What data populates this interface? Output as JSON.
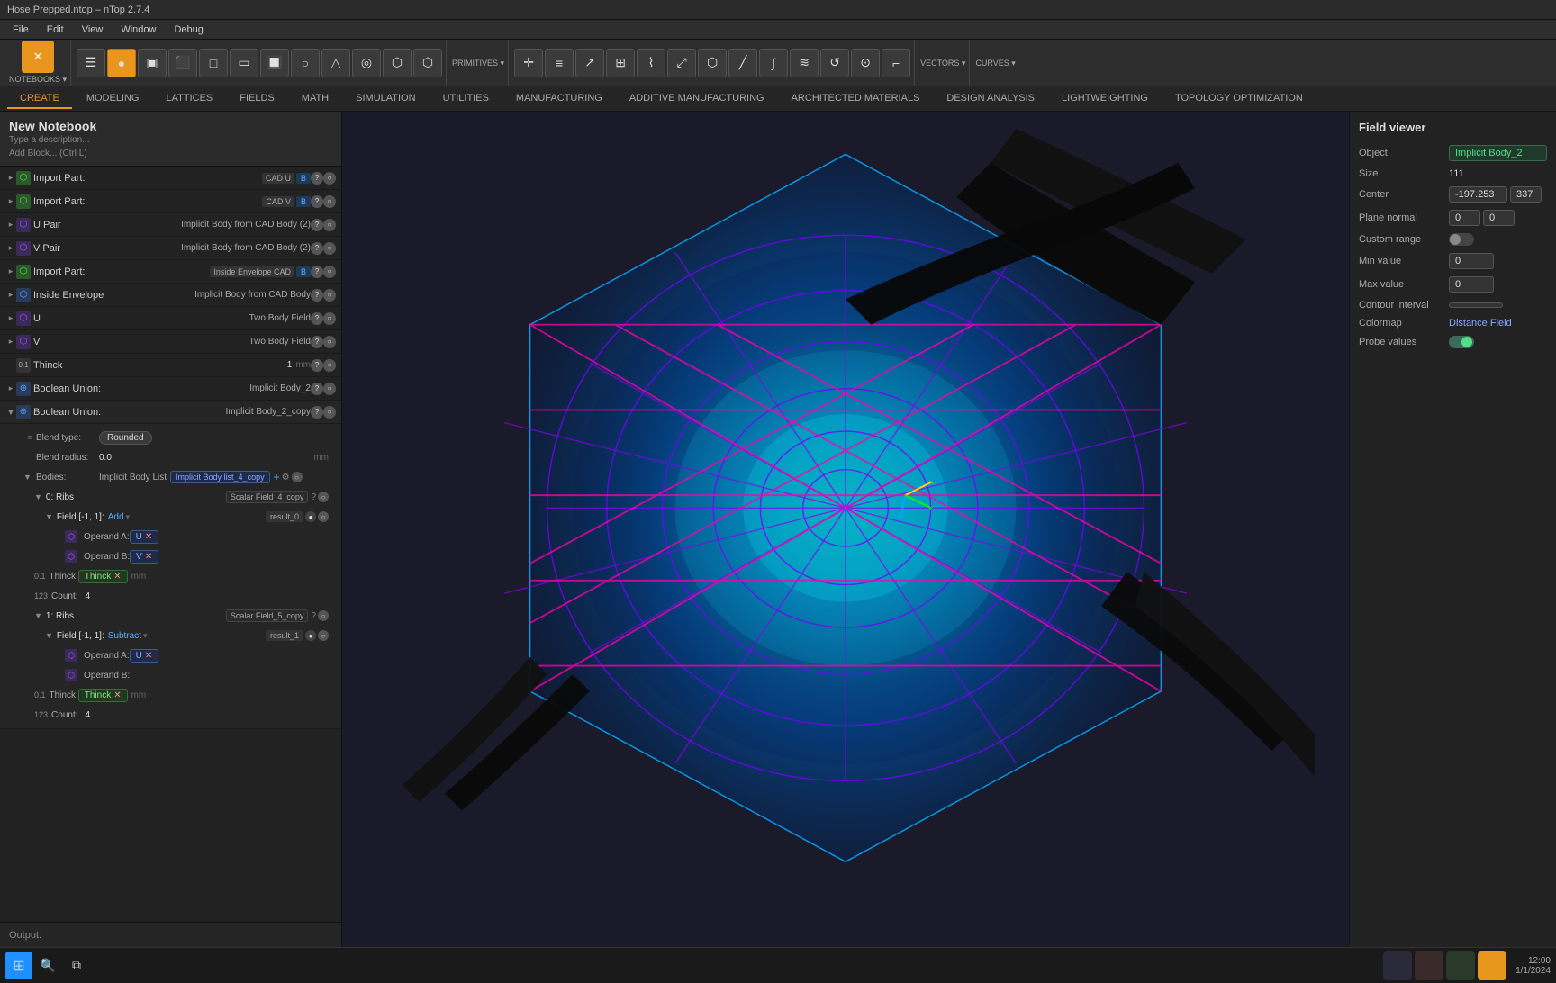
{
  "window": {
    "title": "Hose Prepped.ntop – nTop 2.7.4"
  },
  "menu": {
    "items": [
      "File",
      "Edit",
      "View",
      "Window",
      "Debug"
    ]
  },
  "tabs": {
    "create": "CREATE",
    "modeling": "MODELING",
    "lattices": "LATTICES",
    "fields": "FIELDS",
    "math": "MATH",
    "simulation": "SIMULATION",
    "utilities": "UTILITIES",
    "manufacturing": "MANUFACTURING",
    "additive": "ADDITIVE MANUFACTURING",
    "architected": "ARCHITECTED MATERIALS",
    "design_analysis": "DESIGN ANALYSIS",
    "lightweighting": "LIGHTWEIGHTING",
    "topology": "TOPOLOGY OPTIMIZATION"
  },
  "notebook": {
    "title": "New Notebook",
    "description": "Type a description...",
    "add_block": "Add Block... (Ctrl L)"
  },
  "tree": {
    "items": [
      {
        "id": "import-part-1",
        "name": "Import Part:",
        "tag": "CAD U",
        "badge": "B",
        "indent": 0
      },
      {
        "id": "import-part-2",
        "name": "Import Part:",
        "tag": "CAD V",
        "badge": "B",
        "indent": 0
      },
      {
        "id": "u-pair",
        "name": "U Pair",
        "subtitle": "Implicit Body from CAD Body (2)",
        "indent": 0
      },
      {
        "id": "v-pair",
        "name": "V Pair",
        "subtitle": "Implicit Body from CAD Body (2)",
        "indent": 0
      },
      {
        "id": "import-part-3",
        "name": "Import Part:",
        "tag": "Inside Envelope CAD",
        "badge": "B",
        "indent": 0
      },
      {
        "id": "inside-envelope",
        "name": "Inside Envelope",
        "subtitle": "Implicit Body from CAD Body",
        "indent": 0
      },
      {
        "id": "u",
        "name": "U",
        "subtitle": "Two Body Field",
        "indent": 0
      },
      {
        "id": "v",
        "name": "V",
        "subtitle": "Two Body Field",
        "indent": 0
      },
      {
        "id": "thinck-1",
        "name": "Thinck",
        "value": "1",
        "unit": "mm",
        "indent": 0
      },
      {
        "id": "boolean-union-1",
        "name": "Boolean Union:",
        "subtitle": "Implicit Body_2",
        "indent": 0
      },
      {
        "id": "boolean-union-2",
        "name": "Boolean Union:",
        "subtitle": "Implicit Body_2_copy",
        "indent": 0
      }
    ],
    "boolean_union_detail": {
      "blend_type_label": "Blend type:",
      "blend_type_value": "Rounded",
      "blend_radius_label": "Blend radius:",
      "blend_radius_value": "0.0",
      "blend_radius_unit": "mm",
      "bodies_label": "Bodies:",
      "bodies_value": "Implicit Body List",
      "bodies_tag": "Implicit Body list_4_copy",
      "ribs_0": {
        "label": "0: Ribs",
        "scalar": "Scalar Field_4_copy",
        "field_label": "Field [-1, 1]:",
        "field_op": "Add",
        "result": "result_0",
        "operand_a": "U",
        "operand_b": "V",
        "thinck_label": "Thinck:",
        "thinck_value": "Thinck",
        "count_label": "Count:",
        "count_value": "4"
      },
      "ribs_1": {
        "label": "1: Ribs",
        "scalar": "Scalar Field_5_copy",
        "field_label": "Field [-1, 1]:",
        "field_op": "Subtract",
        "result": "result_1",
        "operand_a": "U",
        "thinck_label": "Thinck:",
        "thinck_value": "Thinck",
        "count_label": "Count:",
        "count_value": "4"
      }
    }
  },
  "field_viewer": {
    "title": "Field viewer",
    "object_label": "Object",
    "object_value": "Implicit Body_2",
    "size_label": "Size",
    "size_value": "111",
    "center_label": "Center",
    "center_value_x": "-197.253",
    "center_value_y": "337",
    "plane_normal_label": "Plane normal",
    "plane_normal_x": "0",
    "plane_normal_y": "0",
    "custom_range_label": "Custom range",
    "min_value_label": "Min value",
    "min_value": "0",
    "max_value_label": "Max value",
    "max_value": "0",
    "contour_interval_label": "Contour interval",
    "colormap_label": "Colormap",
    "colormap_value": "Distance Field",
    "probe_values_label": "Probe values"
  },
  "bottom": {
    "output_label": "Output:"
  },
  "icons": {
    "arrow_right": "▶",
    "arrow_down": "▼",
    "arrow_left": "◀",
    "close": "✕",
    "plus": "+",
    "gear": "⚙",
    "eye": "👁",
    "question": "?",
    "circle": "●",
    "chevron_down": "▾",
    "chevron_right": "▸",
    "link": "⬡"
  }
}
